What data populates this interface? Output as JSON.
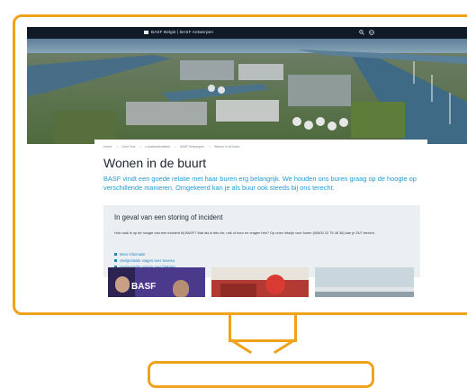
{
  "site": {
    "brand": "BASF Belgie | BASF Antwerpen",
    "topbar_icons": [
      "search-icon",
      "language-icon"
    ]
  },
  "breadcrumb": [
    "Home",
    "Over Ons",
    "Locatieactiviteiten",
    "BASF Antwerpen",
    "Wonen in de buurt"
  ],
  "page": {
    "title": "Wonen in de buurt",
    "intro": "BASF vindt een goede relatie met haar buren erg belangrijk. We houden ons buren graag op de hoogte op verschillende manieren. Omgekeerd kan je als buur ook steeds bij ons terecht."
  },
  "incident": {
    "title": "In geval van een storing of incident",
    "question": "Hoe raak ik op de hoogte van een incident bij BASF? Wat als ik iets zie, ruik of hoor en vragen heb? Op onze infolijn voor buren (00800 22 75 46 36) kan je 24/7 terecht.",
    "links": [
      "Meer informatie",
      "Veelgestelde vragen over Seveso",
      "Veelgestelde vragen over fakkelen"
    ]
  },
  "thumbnails": [
    "BASF"
  ],
  "colors": {
    "frame": "#f0a21b",
    "accent_blue": "#1e9ad6",
    "topbar": "#0f1a26"
  }
}
